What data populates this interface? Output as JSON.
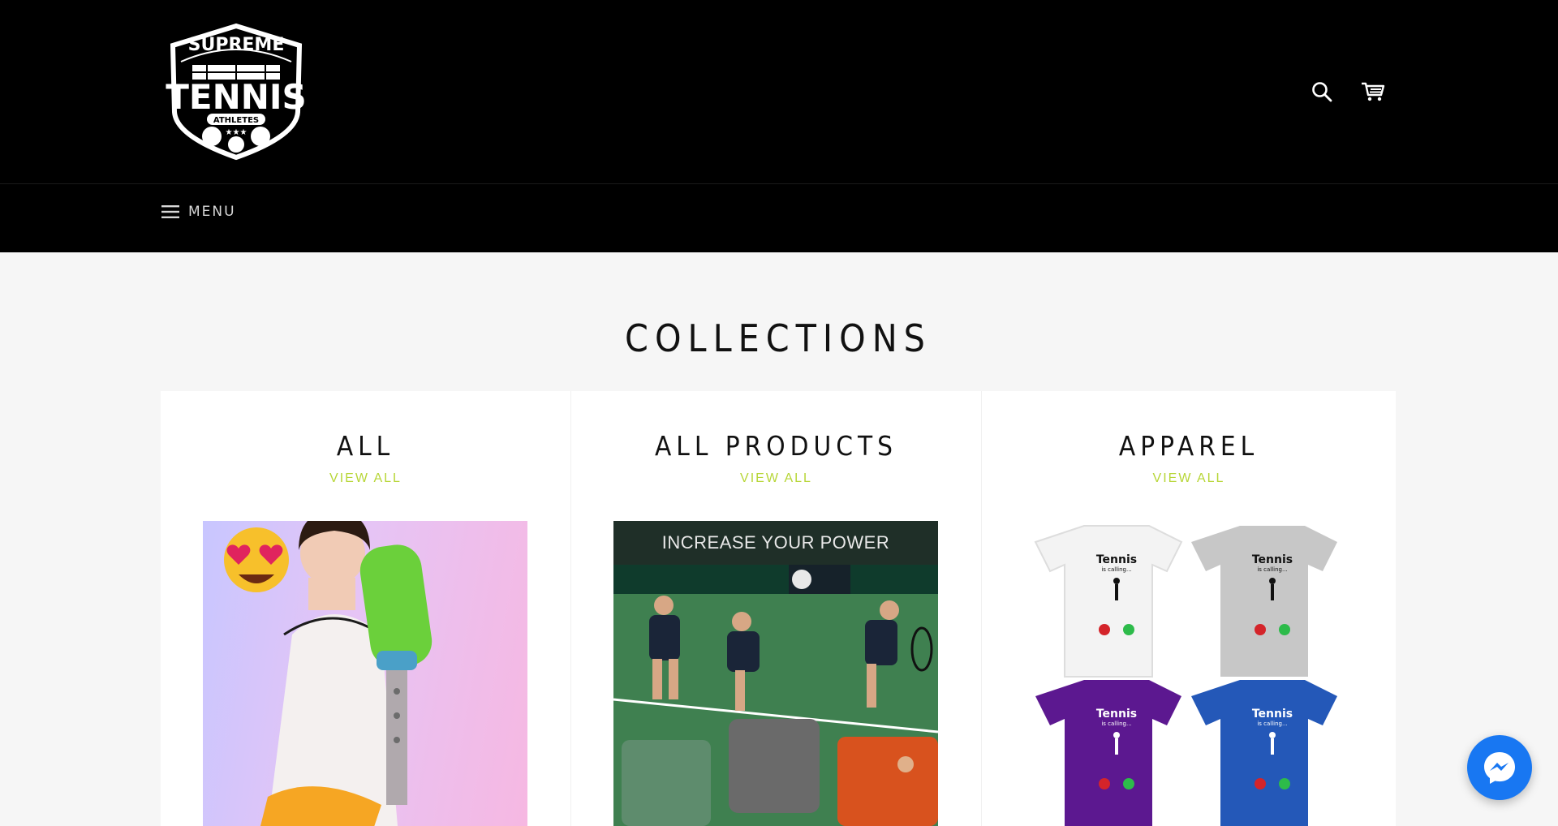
{
  "header": {
    "logo": {
      "line1": "SUPREME",
      "line2": "TENNIS",
      "line3": "ATHLETES"
    },
    "search_icon": "search-icon",
    "cart_icon": "cart-icon"
  },
  "nav": {
    "menu_label": "MENU",
    "menu_icon": "hamburger-icon"
  },
  "page": {
    "title": "COLLECTIONS"
  },
  "collections": [
    {
      "title": "ALL",
      "link": "VIEW ALL",
      "image": "woman-with-tennis-ball-collector"
    },
    {
      "title": "ALL PRODUCTS",
      "link": "VIEW ALL",
      "image": "tennis-serve-sequence",
      "banner": "INCREASE YOUR POWER"
    },
    {
      "title": "APPAREL",
      "link": "VIEW ALL",
      "image": "tennis-is-calling-tshirts"
    }
  ],
  "tshirt": {
    "title": "Tennis",
    "subtitle": "is calling..."
  },
  "colors": {
    "header_bg": "#000000",
    "page_bg": "#f6f6f6",
    "accent": "#b7d637",
    "messenger": "#1877f2"
  },
  "messenger": {
    "icon": "messenger-icon"
  }
}
